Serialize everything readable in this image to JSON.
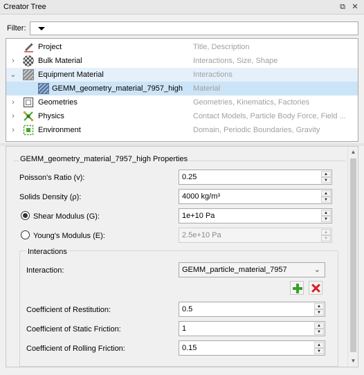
{
  "window": {
    "title": "Creator Tree",
    "float_icon": "float-icon",
    "close_icon": "close-icon"
  },
  "filter": {
    "label": "Filter:",
    "value": ""
  },
  "tree": {
    "items": [
      {
        "label": "Project",
        "description": "Title, Description",
        "icon": "pencil-icon",
        "expander": "",
        "level": 0
      },
      {
        "label": "Bulk Material",
        "description": "Interactions, Size, Shape",
        "icon": "bulk-material-icon",
        "expander": "›",
        "level": 0
      },
      {
        "label": "Equipment Material",
        "description": "Interactions",
        "icon": "equipment-material-icon",
        "expander": "⌄",
        "level": 0
      },
      {
        "label": "GEMM_geometry_material_7957_high",
        "description": "Material",
        "icon": "equipment-material-icon",
        "expander": "",
        "level": 1
      },
      {
        "label": "Geometries",
        "description": "Geometries, Kinematics, Factories",
        "icon": "geometry-icon",
        "expander": "›",
        "level": 0
      },
      {
        "label": "Physics",
        "description": "Contact Models, Particle Body Force, Field ...",
        "icon": "physics-icon",
        "expander": "›",
        "level": 0
      },
      {
        "label": "Environment",
        "description": "Domain, Periodic Boundaries, Gravity",
        "icon": "environment-icon",
        "expander": "›",
        "level": 0
      }
    ]
  },
  "properties": {
    "title": "GEMM_geometry_material_7957_high Properties",
    "poisson_label": "Poisson's Ratio (v):",
    "poisson_value": "0.25",
    "density_label": "Solids Density (ρ):",
    "density_value": "4000 kg/m³",
    "shear_label": "Shear Modulus (G):",
    "shear_value": "1e+10 Pa",
    "shear_selected": true,
    "young_label": "Young's Modulus (E):",
    "young_value": "2.5e+10 Pa",
    "young_selected": false
  },
  "interactions": {
    "group_label": "Interactions",
    "interaction_label": "Interaction:",
    "interaction_value": "GEMM_particle_material_7957",
    "add_icon": "plus-icon",
    "remove_icon": "x-icon",
    "restitution_label": "Coefficient of Restitution:",
    "restitution_value": "0.5",
    "static_friction_label": "Coefficient of Static Friction:",
    "static_friction_value": "1",
    "rolling_friction_label": "Coefficient of Rolling Friction:",
    "rolling_friction_value": "0.15"
  },
  "colors": {
    "selection": "#cce4f7",
    "hover": "#e5f0fb",
    "add_green": "#3aa02c",
    "remove_red": "#d62222"
  }
}
